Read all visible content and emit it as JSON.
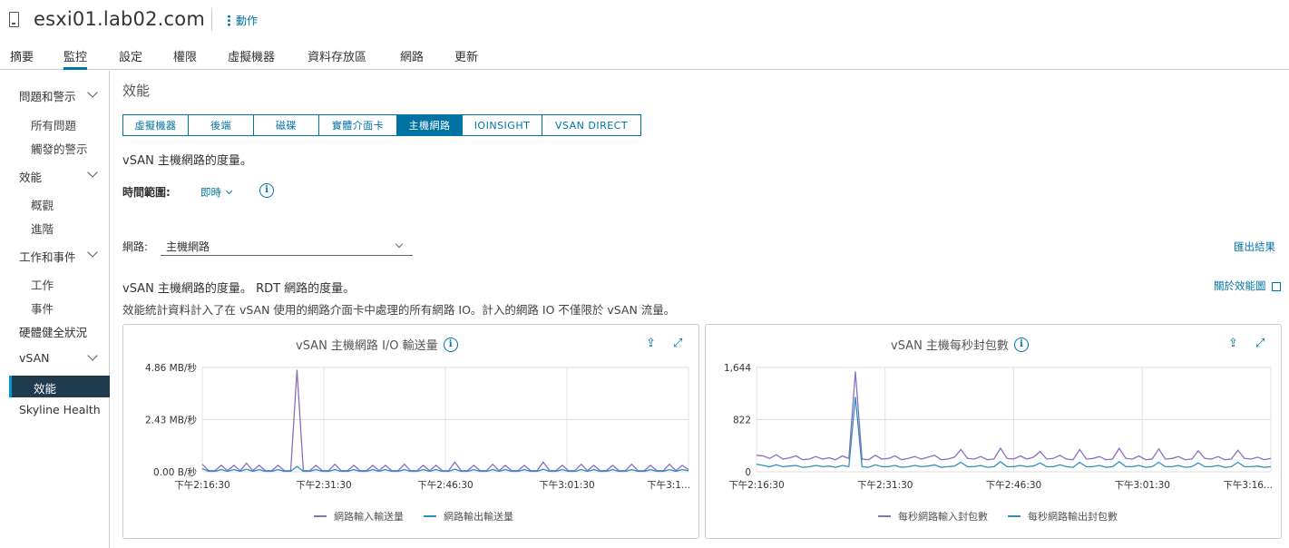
{
  "header": {
    "host_name": "esxi01.lab02.com",
    "actions_label": "動作",
    "host_icon": "host-icon"
  },
  "tabs": [
    {
      "label": "摘要"
    },
    {
      "label": "監控",
      "active": true
    },
    {
      "label": "設定"
    },
    {
      "label": "權限"
    },
    {
      "label": "虛擬機器"
    },
    {
      "label": "資料存放區"
    },
    {
      "label": "網路"
    },
    {
      "label": "更新"
    }
  ],
  "sidebar": {
    "groups": [
      {
        "label": "問題和警示",
        "items": [
          "所有問題",
          "觸發的警示"
        ]
      },
      {
        "label": "效能",
        "items": [
          "概觀",
          "進階"
        ]
      },
      {
        "label": "工作和事件",
        "items": [
          "工作",
          "事件"
        ]
      },
      {
        "label": "硬體健全狀況"
      },
      {
        "label": "vSAN",
        "items": [
          "效能"
        ]
      },
      {
        "label": "Skyline Health"
      }
    ],
    "active_item": "效能"
  },
  "main": {
    "title": "效能",
    "subtabs": [
      "虛擬機器",
      "後端",
      "磁碟",
      "實體介面卡",
      "主機網路",
      "IOINSIGHT",
      "VSAN DIRECT"
    ],
    "active_subtab": "主機網路",
    "desc": "vSAN 主機網路的度量。",
    "time_range_label": "時間範圍:",
    "time_range_value": "即時",
    "network_label": "網路:",
    "network_value": "主機網路",
    "export_label": "匯出結果",
    "metrics_desc": "vSAN 主機網路的度量。 RDT 網路的度量。",
    "about_label": "關於效能圖",
    "stats_note": "效能統計資料計入了在 vSAN 使用的網路介面卡中處理的所有網路 IO。計入的網路 IO 不僅限於 vSAN 流量。"
  },
  "colors": {
    "accent": "#0072a3",
    "series_in": "#8a6fc1",
    "series_out": "#2f8fc0",
    "sidebar_active": "#1f3b4d"
  },
  "chart_data": [
    {
      "type": "line",
      "title": "vSAN 主機網路 I/O 輸送量",
      "y_ticks": [
        "4.86 MB/秒",
        "2.43 MB/秒",
        "0.00 B/秒"
      ],
      "ylim": [
        0,
        4.86
      ],
      "y_unit": "MB/秒",
      "x_ticks": [
        "下午2:16:30",
        "下午2:31:30",
        "下午2:46:30",
        "下午3:01:30",
        "下午3:1..."
      ],
      "series": [
        {
          "name": "網路輸入輸送量",
          "color": "#8a6fc1",
          "values": [
            0.35,
            0.05,
            0.05,
            0.3,
            0.05,
            0.3,
            0.05,
            0.4,
            0.05,
            0.3,
            0.05,
            0.05,
            0.3,
            0.05,
            0.05,
            4.75,
            0.05,
            0.05,
            0.3,
            0.05,
            0.05,
            0.35,
            0.05,
            0.05,
            0.3,
            0.05,
            0.05,
            0.3,
            0.05,
            0.3,
            0.05,
            0.05,
            0.35,
            0.05,
            0.05,
            0.3,
            0.05,
            0.3,
            0.05,
            0.05,
            0.45,
            0.05,
            0.05,
            0.3,
            0.05,
            0.05,
            0.35,
            0.05,
            0.3,
            0.05,
            0.05,
            0.3,
            0.05,
            0.05,
            0.45,
            0.05,
            0.05,
            0.3,
            0.05,
            0.05,
            0.35,
            0.05,
            0.3,
            0.05,
            0.05,
            0.3,
            0.05,
            0.05,
            0.35,
            0.05,
            0.05,
            0.3,
            0.05,
            0.05,
            0.35,
            0.05,
            0.3,
            0.1
          ]
        },
        {
          "name": "網路輸出輸送量",
          "color": "#2f8fc0",
          "values": [
            0.15,
            0.02,
            0.02,
            0.1,
            0.02,
            0.1,
            0.02,
            0.12,
            0.02,
            0.1,
            0.02,
            0.02,
            0.1,
            0.02,
            0.02,
            0.25,
            0.02,
            0.02,
            0.1,
            0.02,
            0.02,
            0.1,
            0.02,
            0.02,
            0.1,
            0.02,
            0.02,
            0.1,
            0.02,
            0.1,
            0.02,
            0.02,
            0.1,
            0.02,
            0.02,
            0.1,
            0.02,
            0.1,
            0.02,
            0.02,
            0.12,
            0.02,
            0.02,
            0.1,
            0.02,
            0.02,
            0.1,
            0.02,
            0.1,
            0.02,
            0.02,
            0.1,
            0.02,
            0.02,
            0.12,
            0.02,
            0.02,
            0.1,
            0.02,
            0.02,
            0.1,
            0.02,
            0.1,
            0.02,
            0.02,
            0.1,
            0.02,
            0.02,
            0.1,
            0.02,
            0.02,
            0.1,
            0.02,
            0.02,
            0.1,
            0.02,
            0.1,
            0.05
          ]
        }
      ]
    },
    {
      "type": "line",
      "title": "vSAN 主機每秒封包數",
      "y_ticks": [
        "1,644",
        "822",
        "0"
      ],
      "ylim": [
        0,
        1644
      ],
      "x_ticks": [
        "下午2:16:30",
        "下午2:31:30",
        "下午2:46:30",
        "下午3:01:30",
        "下午3:16..."
      ],
      "series": [
        {
          "name": "每秒網路輸入封包數",
          "color": "#8a6fc1",
          "values": [
            260,
            250,
            210,
            270,
            200,
            220,
            250,
            190,
            200,
            240,
            200,
            220,
            190,
            250,
            210,
            1580,
            200,
            190,
            260,
            200,
            210,
            250,
            190,
            210,
            240,
            200,
            230,
            260,
            190,
            200,
            230,
            350,
            210,
            200,
            240,
            190,
            200,
            370,
            210,
            200,
            250,
            200,
            230,
            320,
            200,
            210,
            260,
            200,
            190,
            350,
            200,
            210,
            240,
            190,
            200,
            370,
            210,
            200,
            250,
            190,
            200,
            360,
            200,
            210,
            240,
            190,
            200,
            330,
            210,
            200,
            240,
            190,
            200,
            340,
            210,
            200,
            230,
            190,
            210
          ]
        },
        {
          "name": "每秒網路輸出封包數",
          "color": "#2f8fc0",
          "values": [
            120,
            100,
            80,
            110,
            80,
            90,
            100,
            70,
            80,
            100,
            80,
            90,
            70,
            100,
            80,
            1180,
            80,
            70,
            110,
            80,
            80,
            100,
            70,
            80,
            100,
            80,
            90,
            110,
            70,
            80,
            90,
            150,
            80,
            80,
            100,
            70,
            80,
            160,
            80,
            80,
            100,
            80,
            90,
            140,
            80,
            80,
            110,
            80,
            70,
            150,
            80,
            80,
            100,
            70,
            80,
            160,
            80,
            80,
            100,
            70,
            80,
            150,
            80,
            80,
            100,
            70,
            80,
            140,
            80,
            80,
            100,
            70,
            80,
            150,
            80,
            80,
            90,
            70,
            80
          ]
        }
      ]
    }
  ]
}
